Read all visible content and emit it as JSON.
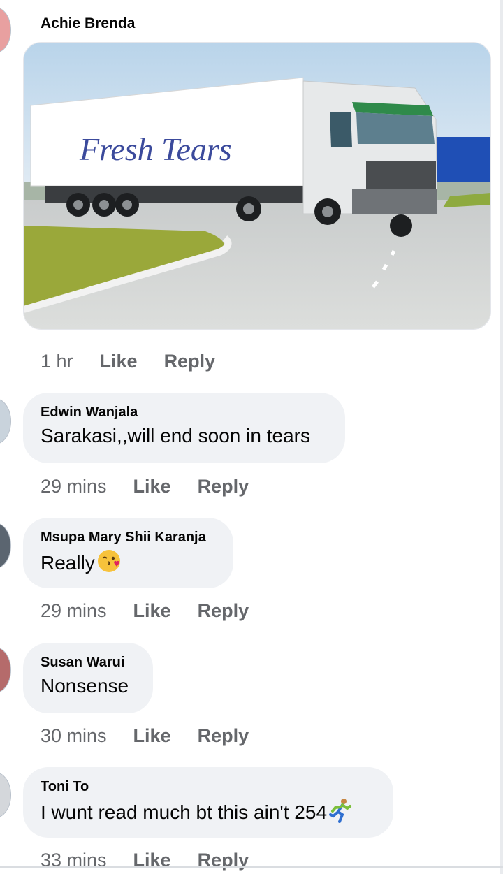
{
  "post": {
    "author": "Achie Brenda",
    "image_caption": "Fresh Tears",
    "time": "1 hr",
    "like_label": "Like",
    "reply_label": "Reply"
  },
  "comments": [
    {
      "author": "Edwin Wanjala",
      "text": "Sarakasi,,will end soon in tears",
      "time": "29 mins",
      "like_label": "Like",
      "reply_label": "Reply"
    },
    {
      "author": "Msupa Mary Shii Karanja",
      "text": "Really",
      "emoji": "kissing-winking-emoji-icon",
      "time": "29 mins",
      "like_label": "Like",
      "reply_label": "Reply"
    },
    {
      "author": "Susan Warui",
      "text": "Nonsense",
      "time": "30 mins",
      "like_label": "Like",
      "reply_label": "Reply"
    },
    {
      "author": "Toni To",
      "text": "I wunt read much bt this ain't 254",
      "emoji": "running-person-icon",
      "time": "33 mins",
      "like_label": "Like",
      "reply_label": "Reply"
    }
  ],
  "colors": {
    "bubble": "#f0f2f5",
    "meta_text": "#65676b",
    "name_text": "#050505",
    "caption_text": "#3b4a9c"
  }
}
